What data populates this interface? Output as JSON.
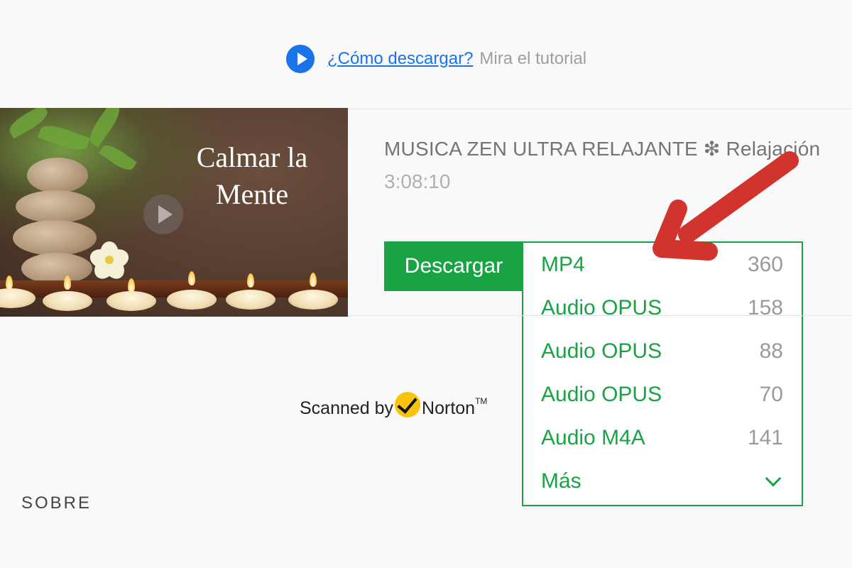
{
  "tutorial": {
    "link_text": "¿Cómo descargar?",
    "hint_text": "Mira el tutorial"
  },
  "video": {
    "thumbnail_text_line1": "Calmar la",
    "thumbnail_text_line2": "Mente",
    "title": "MUSICA ZEN ULTRA RELAJANTE ❇ Relajación",
    "duration": "3:08:10"
  },
  "download": {
    "button_label": "Descargar",
    "formats": [
      {
        "name": "MP4",
        "quality": "360"
      },
      {
        "name": "Audio OPUS",
        "quality": "158"
      },
      {
        "name": "Audio OPUS",
        "quality": "88"
      },
      {
        "name": "Audio OPUS",
        "quality": "70"
      },
      {
        "name": "Audio M4A",
        "quality": "141"
      }
    ],
    "more_label": "Más"
  },
  "badge": {
    "prefix": "Scanned by",
    "brand": "Norton",
    "tm": "TM"
  },
  "footer": {
    "about_label": "SOBRE"
  },
  "colors": {
    "accent_green": "#1aa344",
    "link_blue": "#1a73e8",
    "arrow_red": "#d0342c",
    "norton_yellow": "#f7c40b"
  }
}
